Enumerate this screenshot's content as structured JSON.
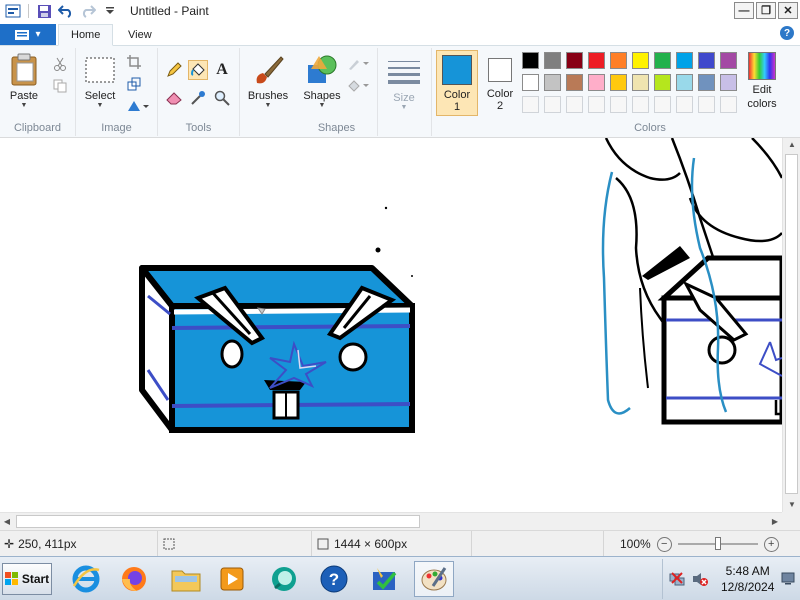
{
  "window": {
    "title": "Untitled - Paint",
    "min": "—",
    "restore": "❐",
    "close": "✕"
  },
  "tabs": {
    "file": "▾",
    "home": "Home",
    "view": "View",
    "help": "?"
  },
  "ribbon": {
    "clipboard": {
      "label": "Clipboard",
      "paste": "Paste"
    },
    "image": {
      "label": "Image",
      "select": "Select"
    },
    "tools": {
      "label": "Tools",
      "text_tool": "A"
    },
    "brushes": {
      "label": "Brushes"
    },
    "shapes": {
      "label": "Shapes",
      "button": "Shapes"
    },
    "size": {
      "label": "Size"
    },
    "color1": {
      "label": "Color",
      "number": "1",
      "value": "#1694d8"
    },
    "color2": {
      "label": "Color",
      "number": "2",
      "value": "#ffffff"
    },
    "colors": {
      "label": "Colors",
      "edit": "Edit",
      "edit2": "colors"
    },
    "palette_row1": [
      "#000000",
      "#7f7f7f",
      "#880015",
      "#ed1c24",
      "#ff7f27",
      "#fff200",
      "#22b14c",
      "#00a2e8",
      "#3f48cc",
      "#a349a4"
    ],
    "palette_row2": [
      "#ffffff",
      "#c3c3c3",
      "#b97a57",
      "#ffaec9",
      "#ffc90e",
      "#efe4b0",
      "#b5e61d",
      "#99d9ea",
      "#7092be",
      "#c8bfe7"
    ]
  },
  "status": {
    "cursor_pos": "250, 411px",
    "selection": "",
    "image_size": "1444 × 600px",
    "zoom": "100%",
    "zoom_out": "−",
    "zoom_in": "+",
    "zoom_level": 100
  },
  "taskbar": {
    "start": "Start",
    "time": "5:48 AM",
    "date": "12/8/2024"
  },
  "drawing": {
    "colors": {
      "fill": "#1694d8",
      "accent": "#3d4ec6",
      "outline": "#000000"
    }
  }
}
